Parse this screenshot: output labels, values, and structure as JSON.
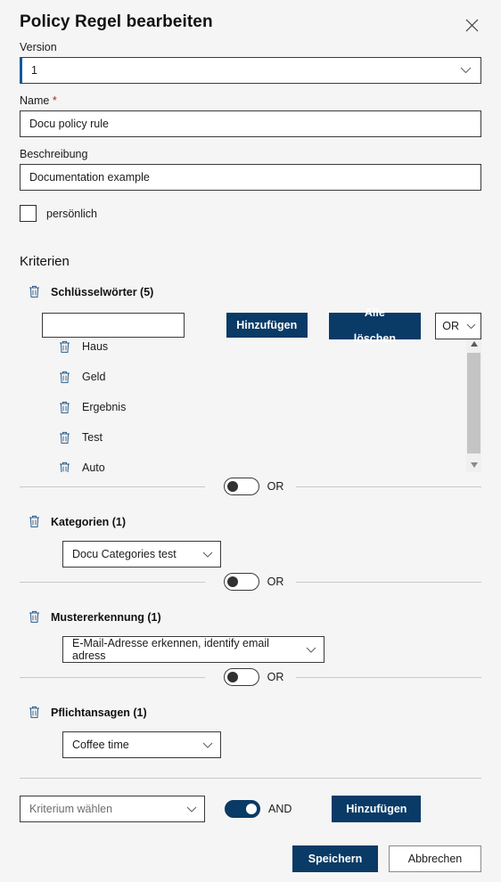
{
  "dialog": {
    "title": "Policy Regel bearbeiten",
    "close_icon": "close-icon"
  },
  "form": {
    "version": {
      "label": "Version",
      "value": "1"
    },
    "name": {
      "label": "Name",
      "required_marker": "*",
      "value": "Docu policy rule",
      "placeholder": ""
    },
    "description": {
      "label": "Beschreibung",
      "value": "Documentation example",
      "placeholder": ""
    },
    "personal": {
      "label": "persönlich",
      "checked": false
    }
  },
  "criteria": {
    "section_title": "Kriterien",
    "keywords": {
      "title": "Schlüsselwörter (5)",
      "delete_icon": "trash-icon",
      "input_value": "",
      "input_placeholder": "",
      "add_label": "Hinzufügen",
      "clear_all_line1": "Alle",
      "clear_all_line2": "löschen",
      "operator": "OR",
      "items": [
        {
          "name": "Haus",
          "delete_icon": "trash-icon"
        },
        {
          "name": "Geld",
          "delete_icon": "trash-icon"
        },
        {
          "name": "Ergebnis",
          "delete_icon": "trash-icon"
        },
        {
          "name": "Test",
          "delete_icon": "trash-icon"
        },
        {
          "name": "Auto",
          "delete_icon": "trash-icon"
        }
      ]
    },
    "dividers": [
      {
        "toggle_state": "off",
        "label": "OR"
      },
      {
        "toggle_state": "off",
        "label": "OR"
      },
      {
        "toggle_state": "off",
        "label": "OR"
      }
    ],
    "categories": {
      "title": "Kategorien (1)",
      "delete_icon": "trash-icon",
      "value": "Docu Categories test"
    },
    "pattern": {
      "title": "Mustererkennung (1)",
      "delete_icon": "trash-icon",
      "value": "E-Mail-Adresse erkennen, identify email adress"
    },
    "announcements": {
      "title": "Pflichtansagen (1)",
      "delete_icon": "trash-icon",
      "value": "Coffee time"
    }
  },
  "footer": {
    "criterion_select_value": "Kriterium wählen",
    "criterion_toggle_state": "on",
    "criterion_toggle_label": "AND",
    "add_label": "Hinzufügen",
    "save_label": "Speichern",
    "cancel_label": "Abbrechen"
  },
  "colors": {
    "primary": "#0a3a66",
    "accent_blue": "#0a5a9c",
    "required_red": "#a4262c",
    "background": "#f5f5f5"
  }
}
